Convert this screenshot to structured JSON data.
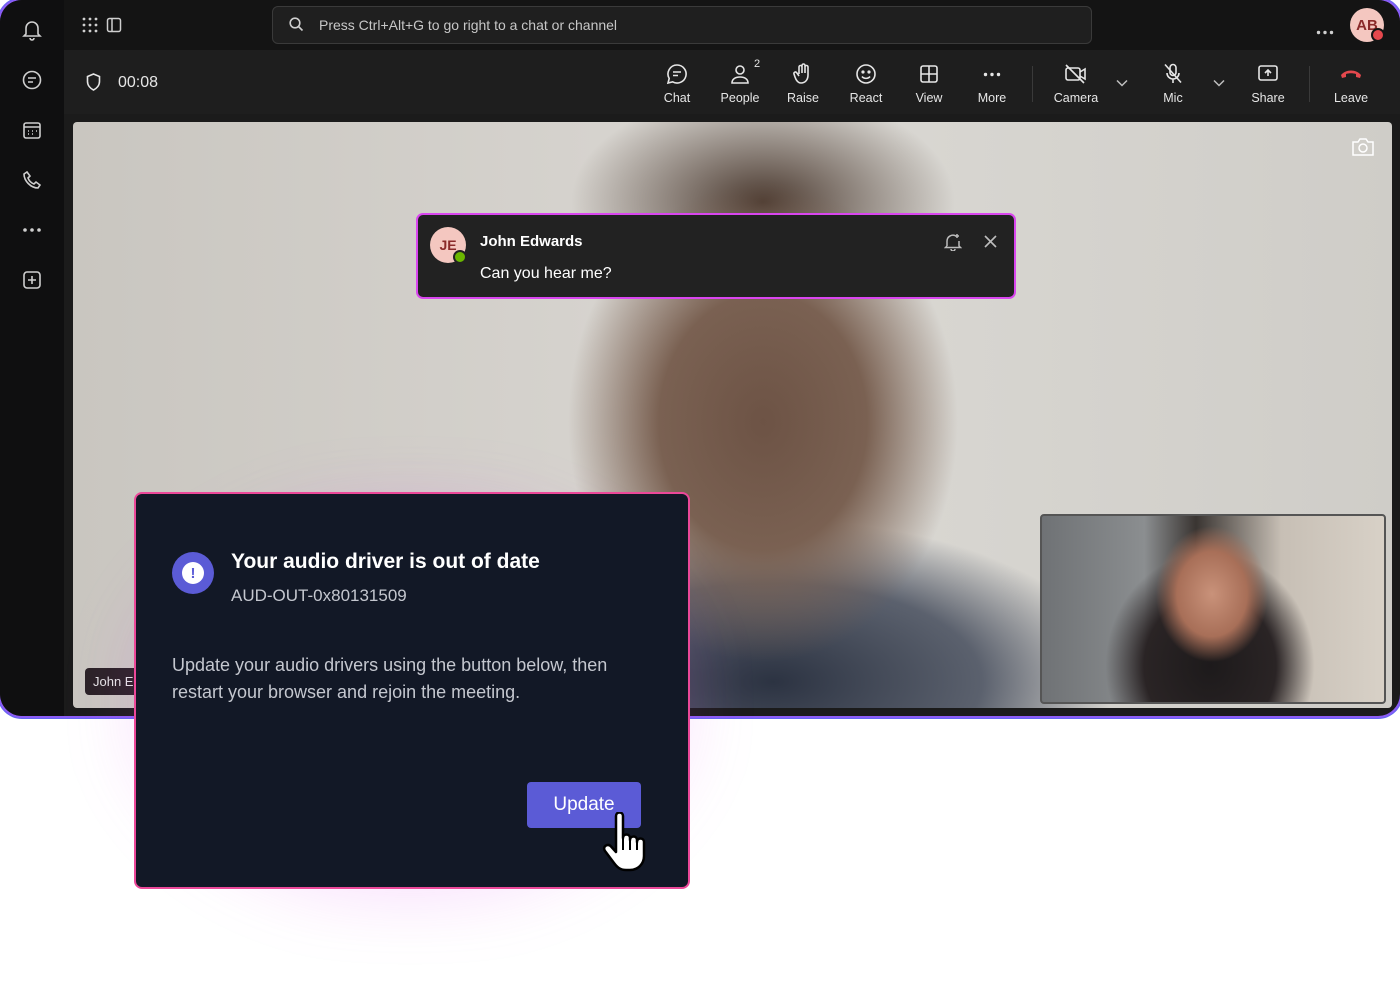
{
  "search": {
    "placeholder": "Press Ctrl+Alt+G to go right to a chat or channel"
  },
  "user": {
    "initials": "AB"
  },
  "call": {
    "timer": "00:08",
    "toolbar": {
      "chat": "Chat",
      "people": "People",
      "people_count": "2",
      "raise": "Raise",
      "react": "React",
      "view": "View",
      "more": "More",
      "camera": "Camera",
      "mic": "Mic",
      "share": "Share",
      "leave": "Leave"
    }
  },
  "stage": {
    "speaker_name_chip": "John Edwards"
  },
  "toast": {
    "initials": "JE",
    "sender": "John Edwards",
    "message": "Can you hear me?"
  },
  "dialog": {
    "title": "Your audio driver is out of date",
    "code": "AUD-OUT-0x80131509",
    "body": "Update your audio drivers using the button below, then restart your browser and rejoin the meeting.",
    "button": "Update"
  },
  "colors": {
    "accent": "#5b5bd6",
    "toast_border": "#d946ef",
    "dialog_border": "#ec4899",
    "leave": "#e5484d"
  }
}
